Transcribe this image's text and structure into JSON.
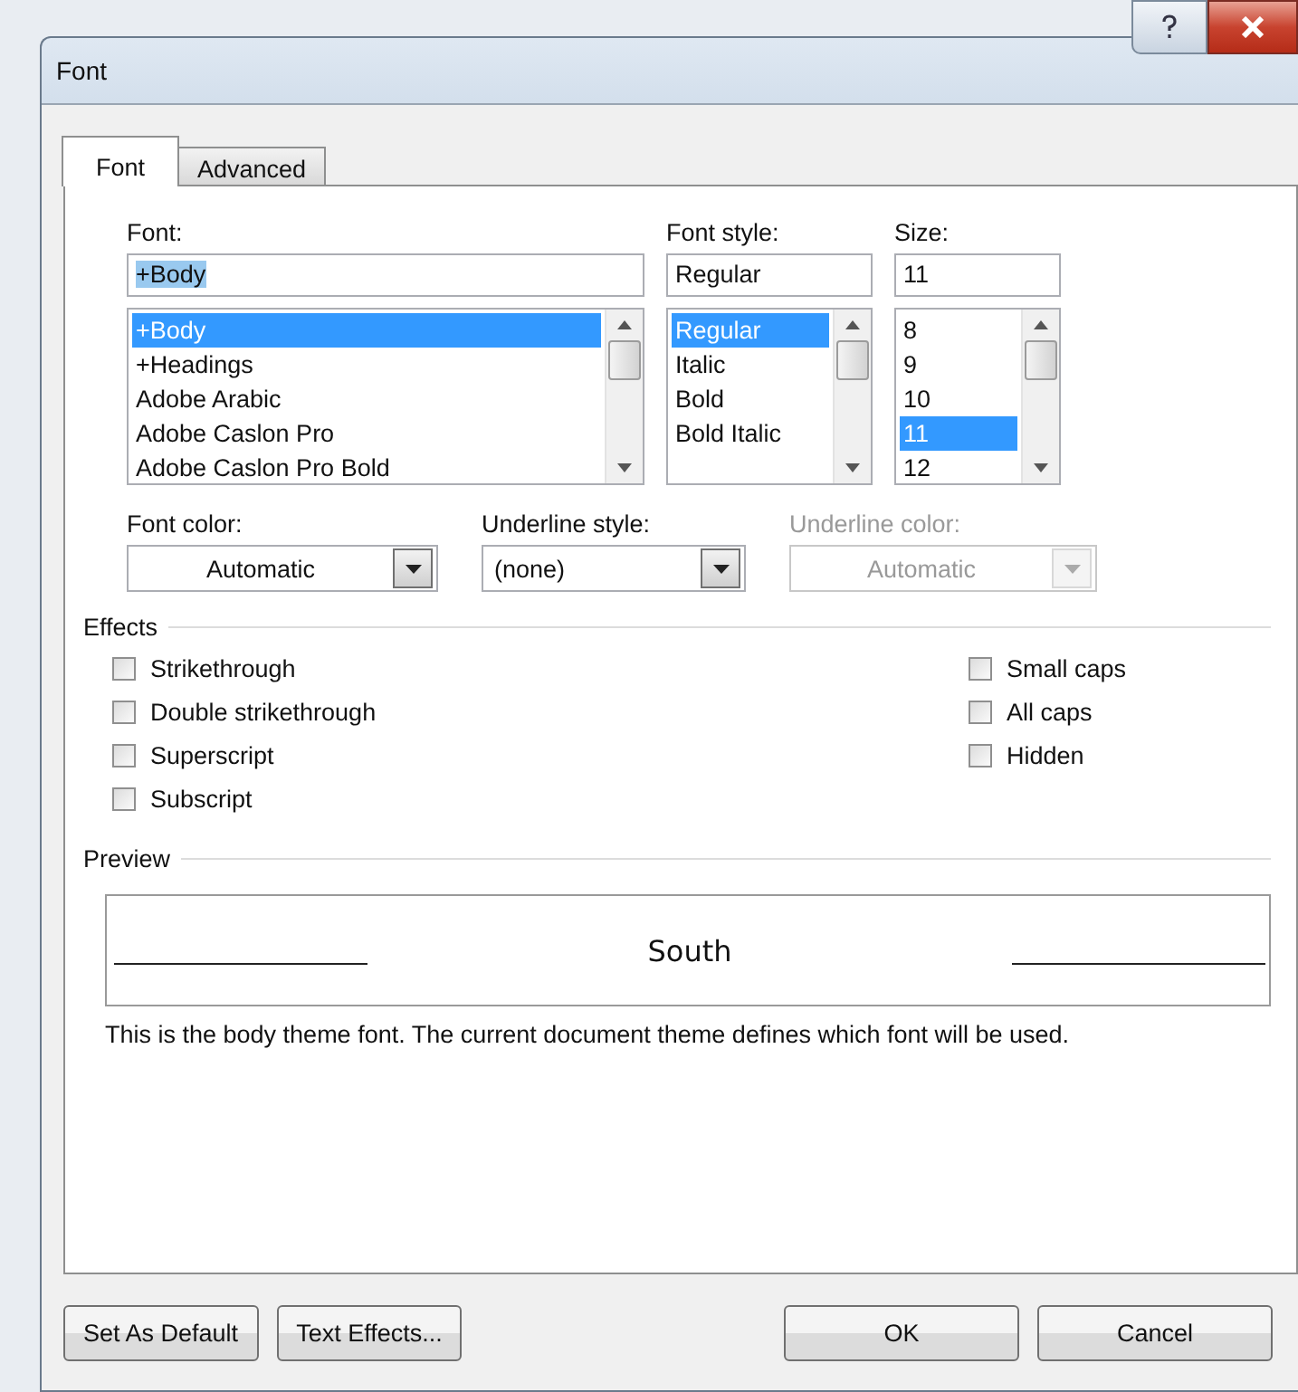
{
  "window": {
    "title": "Font"
  },
  "tabs": [
    {
      "label": "Font",
      "selected": true
    },
    {
      "label": "Advanced",
      "selected": false
    }
  ],
  "font": {
    "label": "Font:",
    "value": "+Body",
    "items": [
      {
        "label": "+Body",
        "selected": true
      },
      {
        "label": "+Headings",
        "selected": false
      },
      {
        "label": "Adobe Arabic",
        "selected": false
      },
      {
        "label": "Adobe Caslon Pro",
        "selected": false
      },
      {
        "label": "Adobe Caslon Pro Bold",
        "selected": false
      }
    ]
  },
  "font_style": {
    "label": "Font style:",
    "value": "Regular",
    "items": [
      {
        "label": "Regular",
        "selected": true
      },
      {
        "label": "Italic",
        "selected": false
      },
      {
        "label": "Bold",
        "selected": false
      },
      {
        "label": "Bold Italic",
        "selected": false
      }
    ]
  },
  "size": {
    "label": "Size:",
    "value": "11",
    "items": [
      {
        "label": "8",
        "selected": false
      },
      {
        "label": "9",
        "selected": false
      },
      {
        "label": "10",
        "selected": false
      },
      {
        "label": "11",
        "selected": true
      },
      {
        "label": "12",
        "selected": false
      }
    ]
  },
  "dropdowns": [
    {
      "label": "Font color:",
      "value": "Automatic",
      "disabled": false,
      "centered": true
    },
    {
      "label": "Underline style:",
      "value": "(none)",
      "disabled": false,
      "centered": false
    },
    {
      "label": "Underline color:",
      "value": "Automatic",
      "disabled": true,
      "centered": true
    }
  ],
  "effects": {
    "title": "Effects",
    "left": [
      {
        "label": "Strikethrough",
        "checked": false
      },
      {
        "label": "Double strikethrough",
        "checked": false
      },
      {
        "label": "Superscript",
        "checked": false
      },
      {
        "label": "Subscript",
        "checked": false
      }
    ],
    "right": [
      {
        "label": "Small caps",
        "checked": false
      },
      {
        "label": "All caps",
        "checked": false
      },
      {
        "label": "Hidden",
        "checked": false
      }
    ]
  },
  "preview": {
    "title": "Preview",
    "sample": "South",
    "note": "This is the body theme font. The current document theme defines which font will be used."
  },
  "buttons": [
    "Set As Default",
    "Text Effects...",
    "OK",
    "Cancel"
  ]
}
